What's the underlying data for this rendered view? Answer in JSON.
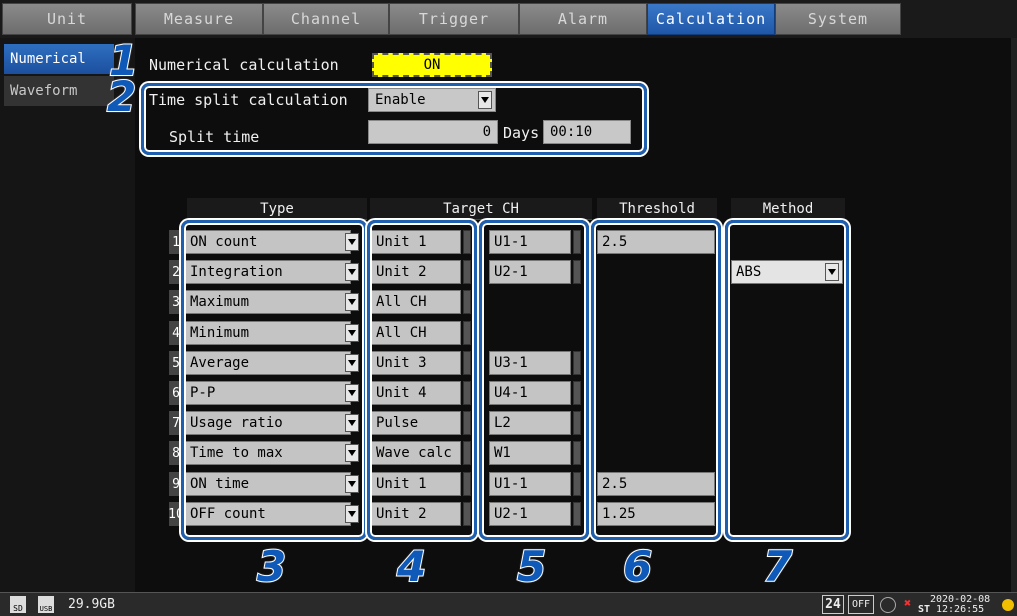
{
  "tabs": [
    "Unit",
    "Measure",
    "Channel",
    "Trigger",
    "Alarm",
    "Calculation",
    "System"
  ],
  "active_tab": "Calculation",
  "side_menu": [
    "Numerical",
    "Waveform"
  ],
  "numerical_calc": {
    "label": "Numerical calculation",
    "value": "ON"
  },
  "time_split": {
    "label": "Time split calculation",
    "value": "Enable"
  },
  "split_time": {
    "label": "Split time",
    "days": "0",
    "days_label": "Days",
    "time": "00:10"
  },
  "columns": {
    "type": "Type",
    "target": "Target CH",
    "threshold": "Threshold",
    "method": "Method"
  },
  "rows": [
    {
      "n": "1",
      "type": "ON count",
      "unit": "Unit 1",
      "ch": "U1-1",
      "threshold": "2.5",
      "method": ""
    },
    {
      "n": "2",
      "type": "Integration",
      "unit": "Unit 2",
      "ch": "U2-1",
      "threshold": "",
      "method": "ABS"
    },
    {
      "n": "3",
      "type": "Maximum",
      "unit": "All CH",
      "ch": "",
      "threshold": "",
      "method": ""
    },
    {
      "n": "4",
      "type": "Minimum",
      "unit": "All CH",
      "ch": "",
      "threshold": "",
      "method": ""
    },
    {
      "n": "5",
      "type": "Average",
      "unit": "Unit 3",
      "ch": "U3-1",
      "threshold": "",
      "method": ""
    },
    {
      "n": "6",
      "type": "P-P",
      "unit": "Unit 4",
      "ch": "U4-1",
      "threshold": "",
      "method": ""
    },
    {
      "n": "7",
      "type": "Usage ratio",
      "unit": "Pulse",
      "ch": "L2",
      "threshold": "",
      "method": ""
    },
    {
      "n": "8",
      "type": "Time to max",
      "unit": "Wave calc",
      "ch": "W1",
      "threshold": "",
      "method": ""
    },
    {
      "n": "9",
      "type": "ON time",
      "unit": "Unit 1",
      "ch": "U1-1",
      "threshold": "2.5",
      "method": ""
    },
    {
      "n": "10",
      "type": "OFF count",
      "unit": "Unit 2",
      "ch": "U2-1",
      "threshold": "1.25",
      "method": ""
    }
  ],
  "callouts": [
    "1",
    "2",
    "3",
    "4",
    "5",
    "6",
    "7"
  ],
  "status": {
    "storage": "29.9GB",
    "sd": "SD",
    "usb": "USB",
    "badge_24": "24",
    "badge_off": "OFF",
    "date": "2020-02-08",
    "st": "ST",
    "time": "12:26:55"
  },
  "colors": {
    "active_tab": "#1f56a8",
    "callout": "#1f5fb0",
    "on_field": "#ffff00"
  }
}
